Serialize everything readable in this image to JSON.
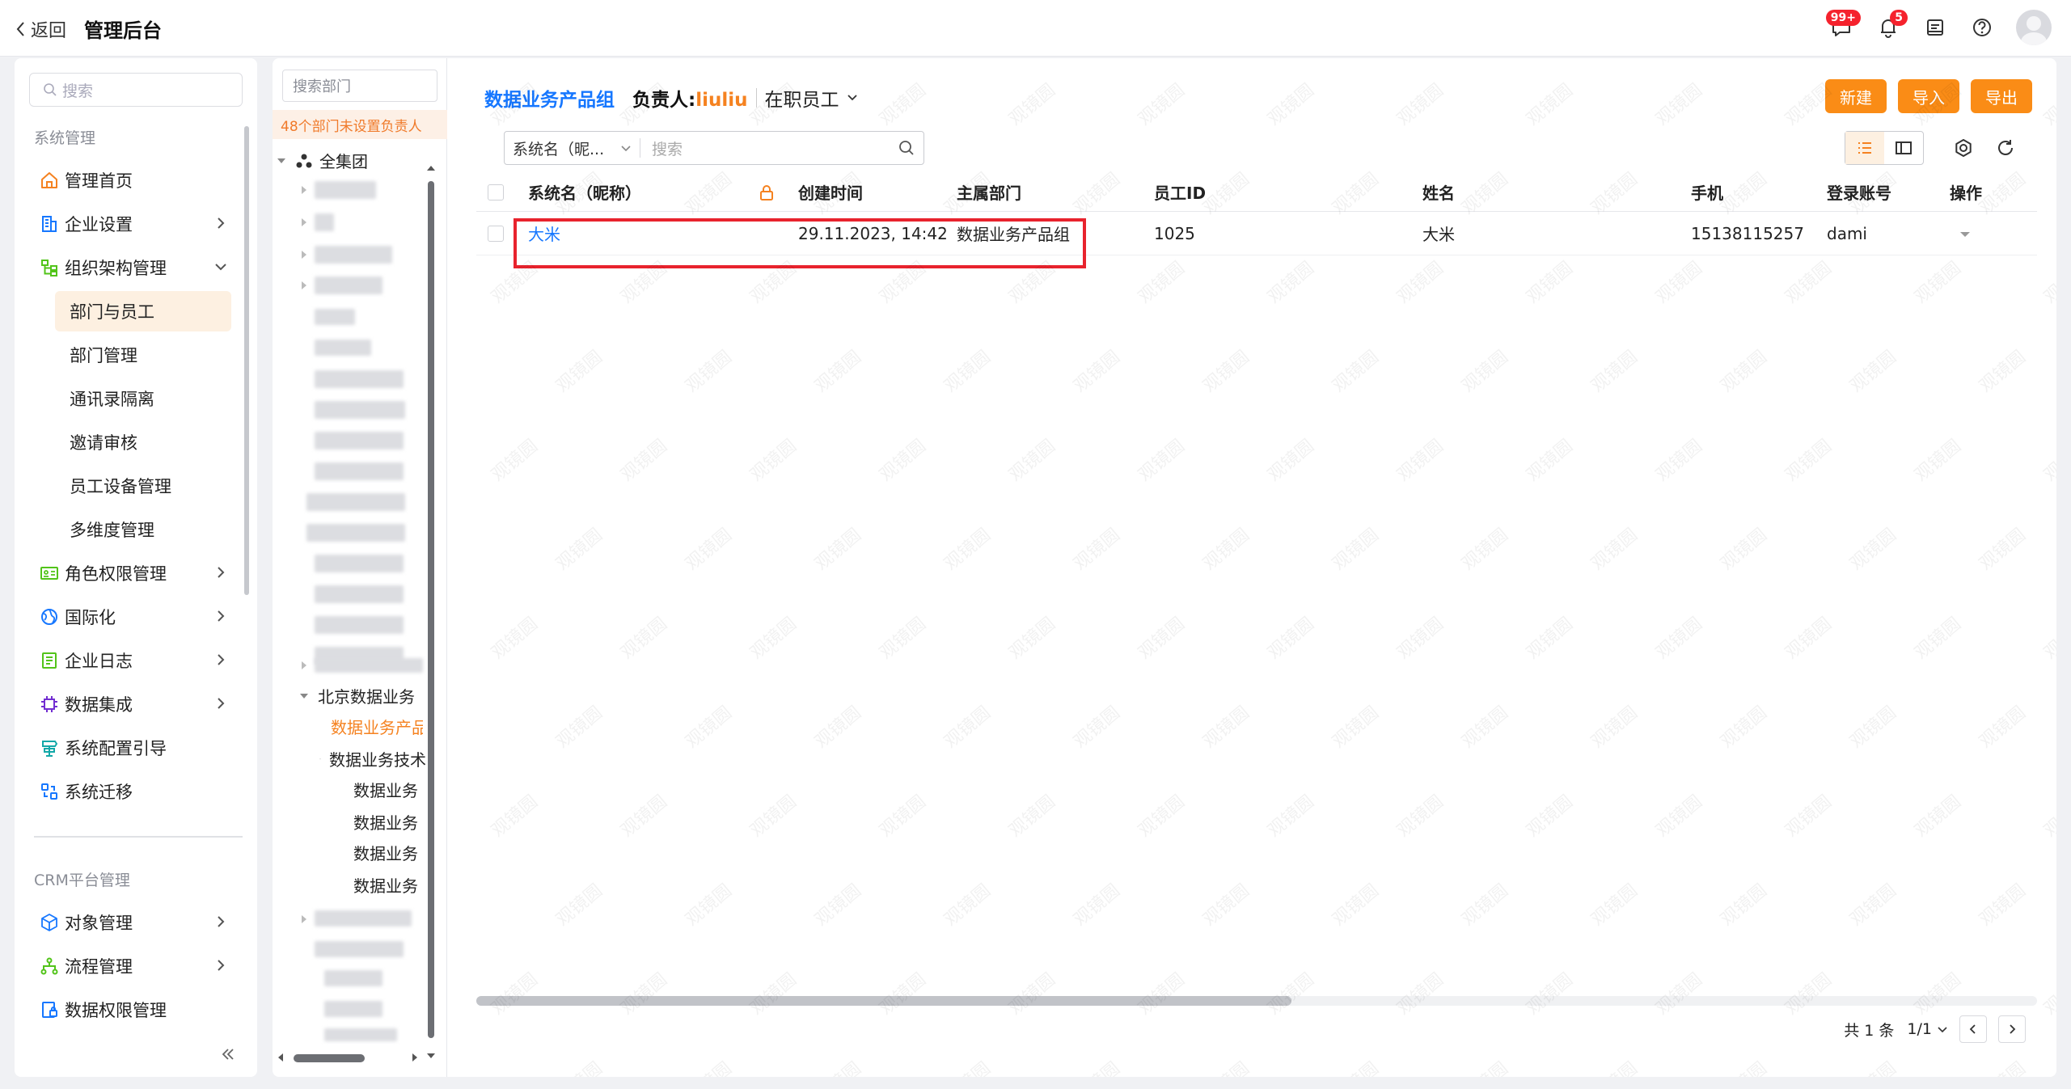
{
  "topbar": {
    "back_label": "返回",
    "app_title": "管理后台",
    "message_badge": "99+",
    "notify_badge": "5"
  },
  "sidebar": {
    "search_placeholder": "搜索",
    "group_system": "系统管理",
    "items": [
      {
        "label": "管理首页",
        "icon": "home-icon"
      },
      {
        "label": "企业设置",
        "icon": "building-icon"
      },
      {
        "label": "组织架构管理",
        "icon": "org-tree-icon"
      },
      {
        "label": "部门与员工",
        "sub": true,
        "active": true
      },
      {
        "label": "部门管理",
        "sub": true
      },
      {
        "label": "通讯录隔离",
        "sub": true
      },
      {
        "label": "邀请审核",
        "sub": true
      },
      {
        "label": "员工设备管理",
        "sub": true
      },
      {
        "label": "多维度管理",
        "sub": true
      },
      {
        "label": "角色权限管理",
        "icon": "role-card-icon"
      },
      {
        "label": "国际化",
        "icon": "globe-icon"
      },
      {
        "label": "企业日志",
        "icon": "log-icon"
      },
      {
        "label": "数据集成",
        "icon": "chip-icon"
      },
      {
        "label": "系统配置引导",
        "icon": "signpost-icon"
      },
      {
        "label": "系统迁移",
        "icon": "migrate-icon"
      }
    ],
    "group_crm": "CRM平台管理",
    "crm_items": [
      {
        "label": "对象管理",
        "icon": "cube-icon"
      },
      {
        "label": "流程管理",
        "icon": "flow-icon"
      },
      {
        "label": "数据权限管理",
        "icon": "data-lock-icon"
      }
    ]
  },
  "tree": {
    "search_placeholder": "搜索部门",
    "warning": "48个部门未设置负责人",
    "root": "全集团",
    "nodes": [
      {
        "label": "北京数据业务部",
        "level": 1
      },
      {
        "label": "数据业务产品组",
        "level": 2,
        "active": true
      },
      {
        "label": "数据业务技术",
        "level": 2
      },
      {
        "label": "数据业务",
        "level": 3
      },
      {
        "label": "数据业务",
        "level": 3
      },
      {
        "label": "数据业务",
        "level": 3
      },
      {
        "label": "数据业务",
        "level": 3
      }
    ]
  },
  "main": {
    "dept_title": "数据业务产品组",
    "owner_label": "负责人:",
    "owner_name": "liuliu",
    "employee_filter": "在职员工",
    "buttons": {
      "new": "新建",
      "import": "导入",
      "export": "导出"
    },
    "filter_field": "系统名（昵...",
    "search_placeholder": "搜索"
  },
  "table": {
    "columns": [
      "系统名（昵称）",
      "创建时间",
      "主属部门",
      "员工ID",
      "姓名",
      "手机",
      "登录账号",
      "操作"
    ],
    "rows": [
      {
        "nickname": "大米",
        "created": "29.11.2023, 14:42",
        "dept": "数据业务产品组",
        "emp_id": "1025",
        "name": "大米",
        "phone": "15138115257",
        "account": "dami"
      }
    ]
  },
  "pager": {
    "total": "共 1 条",
    "page": "1/1"
  },
  "watermark_text": "观镜圆",
  "colors": {
    "accent": "#fa8c16",
    "link": "#1677ff",
    "highlight": "#e8232d"
  }
}
